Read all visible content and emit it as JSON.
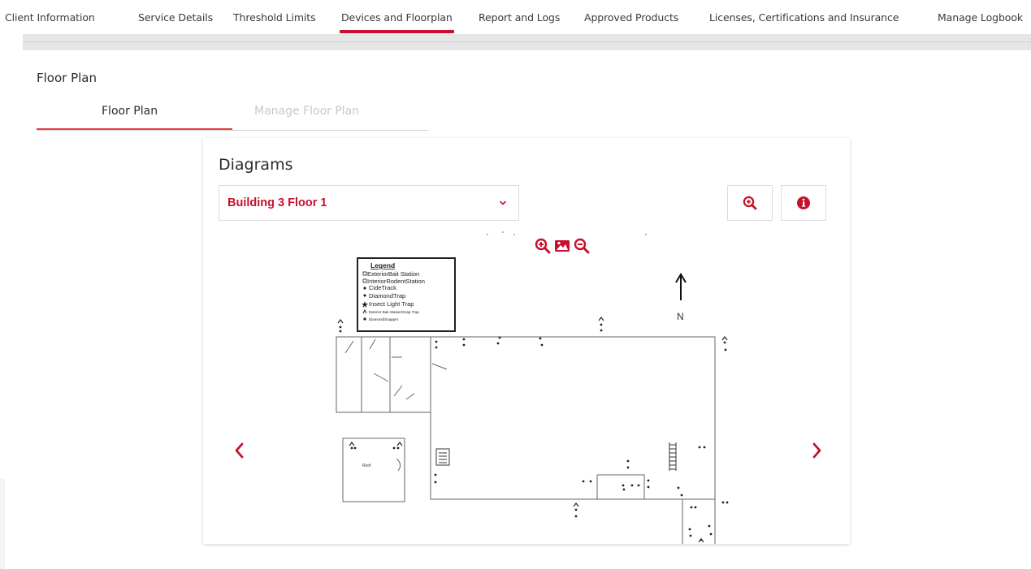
{
  "nav": {
    "tabs": [
      {
        "label": "Client Information"
      },
      {
        "label": "Service Details"
      },
      {
        "label": "Threshold Limits"
      },
      {
        "label": "Devices and Floorplan"
      },
      {
        "label": "Report and Logs"
      },
      {
        "label": "Approved Products"
      },
      {
        "label": "Licenses, Certifications and Insurance"
      },
      {
        "label": "Manage Logbook"
      }
    ],
    "active_index": 3
  },
  "section_title": "Floor Plan",
  "subtabs": [
    {
      "label": "Floor Plan",
      "active": true
    },
    {
      "label": "Manage Floor Plan",
      "active": false
    }
  ],
  "diagrams": {
    "title": "Diagrams",
    "selected": "Building 3 Floor 1"
  },
  "legend": {
    "title": "Legend",
    "items": [
      "ExteriorBait Station",
      "InteriorRodentStation",
      "CideTrack",
      "DiamondTrap",
      "Insect Light Trap",
      "Exterior Bait Station/Snap Trap",
      "Diamond/Snapper"
    ]
  },
  "plan_labels": {
    "north": "N",
    "room": "Roof"
  },
  "colors": {
    "accent": "#c8102e",
    "active_underline": "#e2434a",
    "muted_tab": "#c9c9c9",
    "divider": "#e6e6e6"
  },
  "icons": {
    "select_caret": "chevron-down-icon",
    "search_zoom": "zoom-in-icon",
    "info": "info-circle-icon",
    "map_zoom_in": "zoom-in-icon",
    "map_image": "image-icon",
    "map_zoom_out": "zoom-out-icon",
    "prev": "chevron-left-icon",
    "next": "chevron-right-icon"
  }
}
